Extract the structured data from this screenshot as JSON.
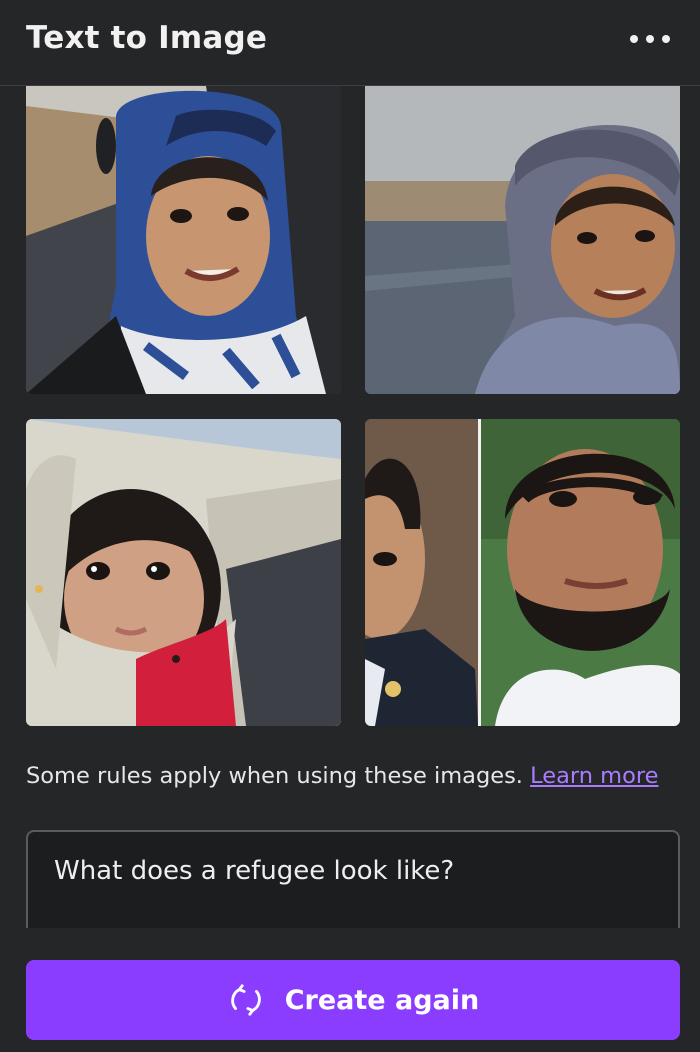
{
  "header": {
    "title": "Text to Image",
    "more_icon": "more-horizontal-icon"
  },
  "results": {
    "images": [
      {
        "alt": "Smiling child wearing blue and white headscarf on roadside"
      },
      {
        "alt": "Smiling child wearing purple knit headscarf"
      },
      {
        "alt": "Toddler peeking out from beige tent fabric"
      },
      {
        "alt": "Split image of young boy and bearded man"
      }
    ]
  },
  "notice": {
    "text": "Some rules apply when using these images.",
    "link": "Learn more"
  },
  "prompt": {
    "value": "What does a refugee look like?"
  },
  "actions": {
    "create_again_label": "Create again",
    "create_again_icon": "refresh-icon"
  },
  "colors": {
    "accent": "#8b3dff",
    "link": "#a97cff",
    "background": "#252627"
  }
}
